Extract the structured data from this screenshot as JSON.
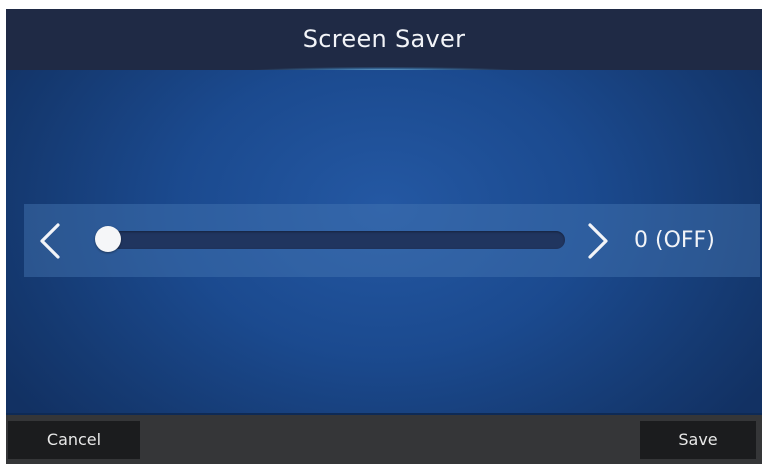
{
  "header": {
    "title": "Screen Saver"
  },
  "slider": {
    "value": 0,
    "min": 0,
    "value_label": "0 (OFF)"
  },
  "footer": {
    "cancel_label": "Cancel",
    "save_label": "Save"
  },
  "icons": {
    "left": "chevron-left-icon",
    "right": "chevron-right-icon"
  },
  "colors": {
    "title_bar": "#1f2a45",
    "background": "#15386b",
    "accent_glow": "#a5e1ff",
    "track": "#20355f",
    "thumb": "#f5f6f8",
    "footer": "#353638",
    "button": "#1b1c1e",
    "text": "#f2f4f8"
  }
}
